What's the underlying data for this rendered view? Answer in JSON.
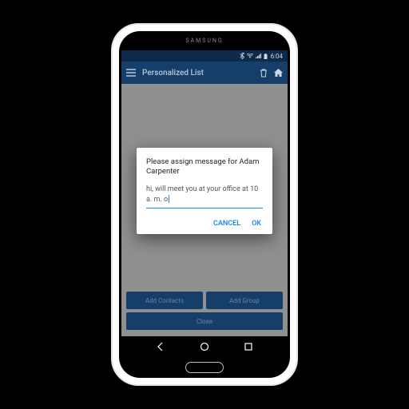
{
  "phone_brand": "SAMSUNG",
  "status": {
    "time": "6:04"
  },
  "appbar": {
    "title": "Personalized List"
  },
  "buttons": {
    "add_contacts": "Add Contacts",
    "add_group": "Add Group",
    "close": "Close"
  },
  "dialog": {
    "title": "Please assign message for Adam Carpenter",
    "input_value": "hi,  will meet you at your office at 10 a. m. o",
    "cancel": "CANCEL",
    "ok": "OK"
  }
}
